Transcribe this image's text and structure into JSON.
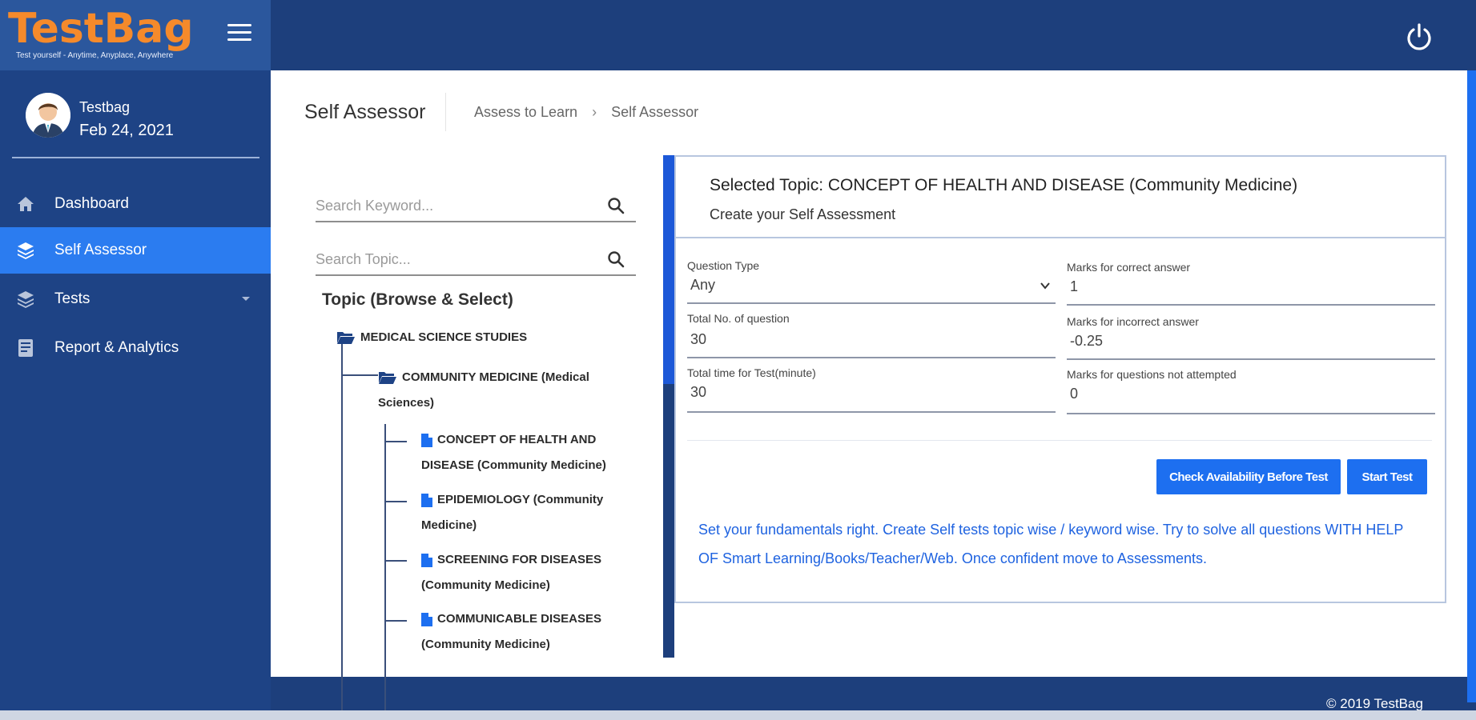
{
  "brand": {
    "name": "TestBag",
    "tagline": "Test yourself - Anytime, Anyplace, Anywhere"
  },
  "user": {
    "name": "Testbag",
    "date": "Feb 24, 2021"
  },
  "sidebar": {
    "items": [
      {
        "label": "Dashboard",
        "icon": "home-icon"
      },
      {
        "label": "Self Assessor",
        "icon": "layers-icon",
        "active": true
      },
      {
        "label": "Tests",
        "icon": "stack-icon",
        "has_submenu": true
      },
      {
        "label": "Report & Analytics",
        "icon": "report-icon"
      }
    ]
  },
  "page": {
    "title": "Self Assessor",
    "breadcrumb": [
      "Assess to Learn",
      "Self Assessor"
    ]
  },
  "search": {
    "keyword_placeholder": "Search Keyword...",
    "topic_placeholder": "Search Topic..."
  },
  "topics": {
    "heading": "Topic (Browse & Select)",
    "root": "MEDICAL SCIENCE STUDIES",
    "subject_line1": "COMMUNITY MEDICINE (Medical",
    "subject_line2": "Sciences)",
    "items": [
      {
        "line1": "CONCEPT OF HEALTH AND",
        "line2": "DISEASE (Community Medicine)"
      },
      {
        "line1": "EPIDEMIOLOGY (Community",
        "line2": "Medicine)"
      },
      {
        "line1": "SCREENING FOR DISEASES",
        "line2": "(Community Medicine)"
      },
      {
        "line1": "COMMUNICABLE DISEASES",
        "line2": "(Community Medicine)"
      }
    ]
  },
  "assessment": {
    "title": "Selected Topic: CONCEPT OF HEALTH AND DISEASE (Community Medicine)",
    "subtitle": "Create your Self Assessment",
    "fields": {
      "question_type": {
        "label": "Question Type",
        "value": "Any"
      },
      "total_questions": {
        "label": "Total No. of question",
        "value": "30"
      },
      "total_time": {
        "label": "Total time for Test(minute)",
        "value": "30"
      },
      "marks_correct": {
        "label": "Marks for correct answer",
        "value": "1"
      },
      "marks_incorrect": {
        "label": "Marks for incorrect answer",
        "value": "-0.25"
      },
      "marks_not_attempted": {
        "label": "Marks for questions not attempted",
        "value": "0"
      }
    },
    "check_button": "Check Availability Before Test",
    "start_button": "Start Test",
    "info": "Set your fundamentals right. Create Self tests topic wise / keyword wise. Try to solve all questions WITH HELP OF Smart Learning/Books/Teacher/Web. Once confident move to Assessments."
  },
  "footer": {
    "copyright": "© 2019 TestBag"
  },
  "colors": {
    "sidebar_bg": "#1e4385",
    "brand_bg": "#2b579d",
    "logo_orange": "#f58a2b",
    "accent_blue": "#1d6ff0",
    "active_nav": "#2b7cf0",
    "info_text": "#1f63e0"
  }
}
